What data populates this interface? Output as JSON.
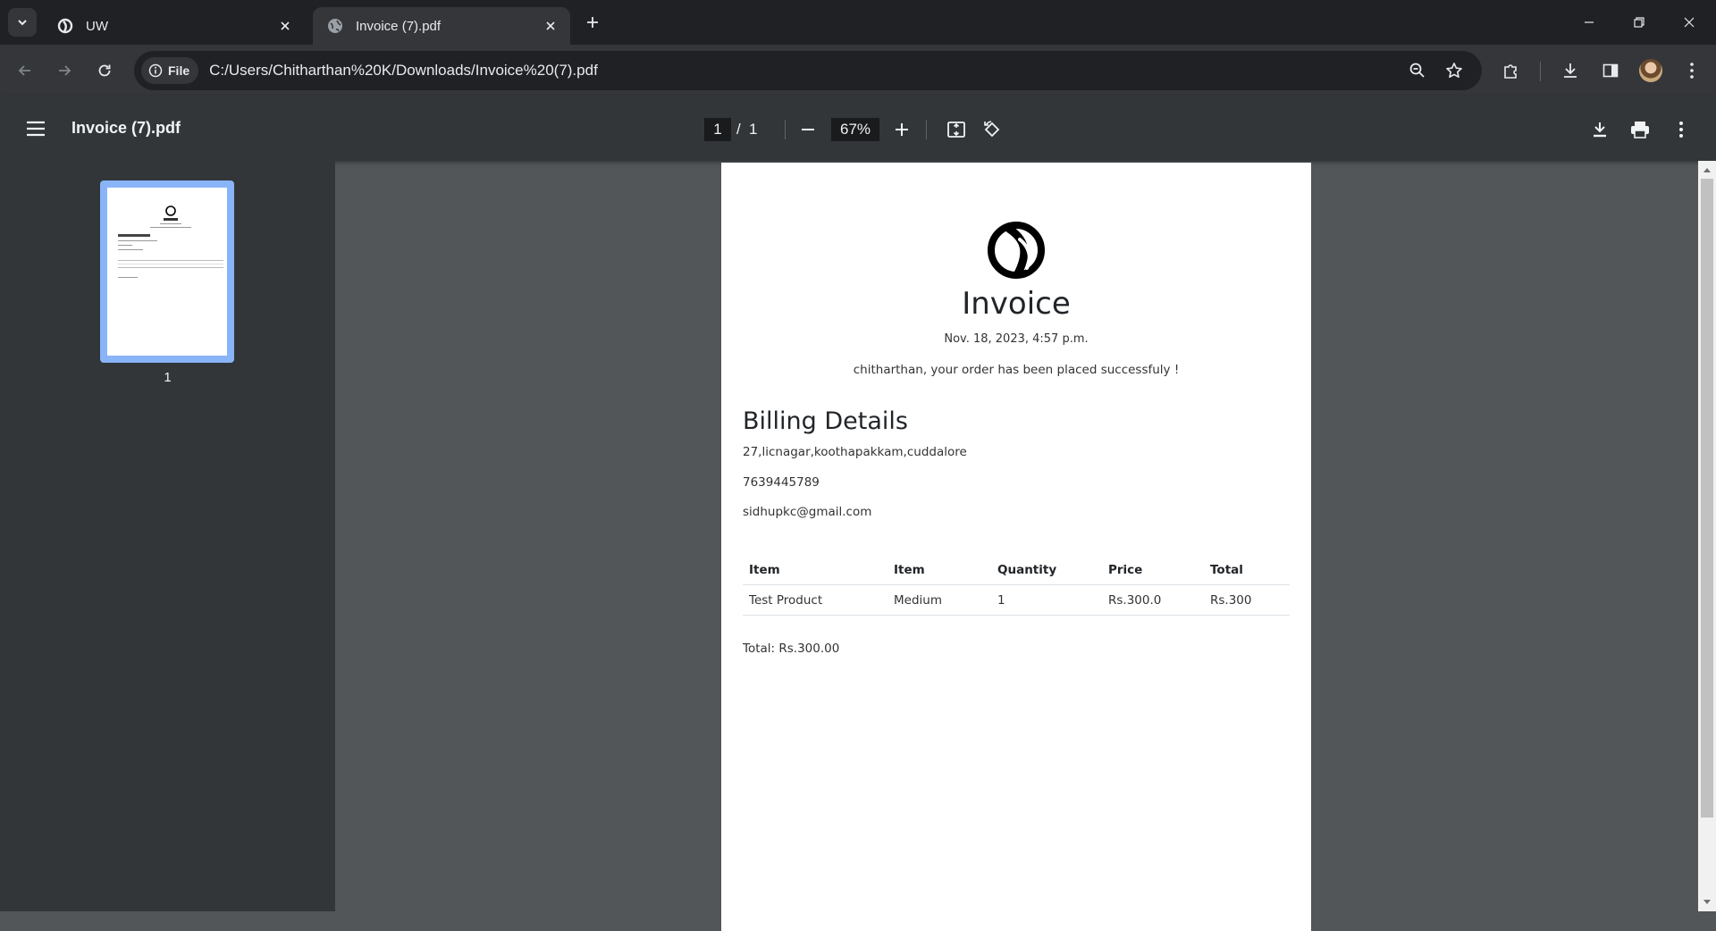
{
  "browser": {
    "tabs": [
      {
        "title": "UW",
        "active": false
      },
      {
        "title": "Invoice (7).pdf",
        "active": true
      }
    ],
    "address": {
      "chip_label": "File",
      "url": "C:/Users/Chitharthan%20K/Downloads/Invoice%20(7).pdf"
    }
  },
  "viewer": {
    "title": "Invoice (7).pdf",
    "page_current": "1",
    "page_separator": "/",
    "page_total": "1",
    "zoom": "67%"
  },
  "sidebar": {
    "thumbnail_label": "1"
  },
  "invoice": {
    "title": "Invoice",
    "date": "Nov. 18, 2023, 4:57 p.m.",
    "message": "chitharthan, your order has been placed successfuly !",
    "billing_heading": "Billing Details",
    "address": "27,licnagar,koothapakkam,cuddalore",
    "phone": "7639445789",
    "email": "sidhupkc@gmail.com",
    "table": {
      "headers": [
        "Item",
        "Item",
        "Quantity",
        "Price",
        "Total"
      ],
      "rows": [
        [
          "Test Product",
          "Medium",
          "1",
          "Rs.300.0",
          "Rs.300"
        ]
      ]
    },
    "total": "Total: Rs.300.00"
  },
  "colors": {
    "thumbnail_highlight": "#8ab4f8",
    "viewer_background": "#525659",
    "toolbar": "#323639"
  }
}
